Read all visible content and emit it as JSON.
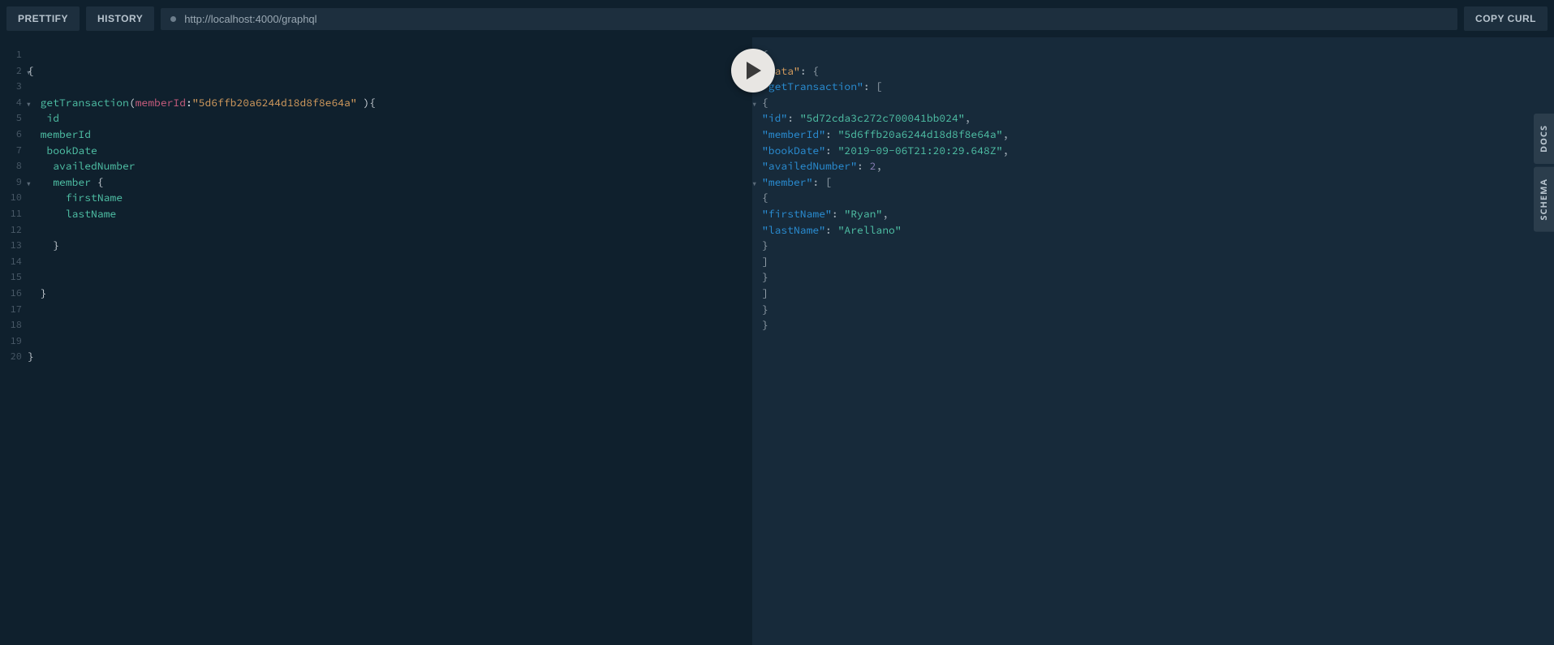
{
  "toolbar": {
    "prettify": "PRETTIFY",
    "history": "HISTORY",
    "copy_curl": "COPY CURL",
    "endpoint": "http://localhost:4000/graphql"
  },
  "side_tabs": {
    "docs": "DOCS",
    "schema": "SCHEMA"
  },
  "query": {
    "lines": [
      {
        "n": 1,
        "txt": ""
      },
      {
        "n": 2,
        "fold": true,
        "txt": "{"
      },
      {
        "n": 3,
        "txt": ""
      },
      {
        "n": 4,
        "fold": true,
        "seg": [
          [
            "  ",
            ""
          ],
          [
            "getTransaction",
            "field"
          ],
          [
            "(",
            "punc"
          ],
          [
            "memberId",
            "arg"
          ],
          [
            ":",
            "punc"
          ],
          [
            "\"5d6ffb20a6244d18d8f8e64a\"",
            "str"
          ],
          [
            " ){",
            "punc"
          ]
        ]
      },
      {
        "n": 5,
        "seg": [
          [
            "   ",
            ""
          ],
          [
            "id",
            "field"
          ]
        ]
      },
      {
        "n": 6,
        "seg": [
          [
            "  ",
            ""
          ],
          [
            "memberId",
            "field"
          ]
        ]
      },
      {
        "n": 7,
        "seg": [
          [
            "   ",
            ""
          ],
          [
            "bookDate",
            "field"
          ]
        ]
      },
      {
        "n": 8,
        "seg": [
          [
            "    ",
            ""
          ],
          [
            "availedNumber",
            "field"
          ]
        ]
      },
      {
        "n": 9,
        "fold": true,
        "seg": [
          [
            "    ",
            ""
          ],
          [
            "member",
            "field"
          ],
          [
            " {",
            "punc"
          ]
        ]
      },
      {
        "n": 10,
        "seg": [
          [
            "      ",
            ""
          ],
          [
            "firstName",
            "field"
          ]
        ]
      },
      {
        "n": 11,
        "seg": [
          [
            "      ",
            ""
          ],
          [
            "lastName",
            "field"
          ]
        ]
      },
      {
        "n": 12,
        "txt": ""
      },
      {
        "n": 13,
        "seg": [
          [
            "    }",
            "punc"
          ]
        ]
      },
      {
        "n": 14,
        "txt": ""
      },
      {
        "n": 15,
        "txt": ""
      },
      {
        "n": 16,
        "seg": [
          [
            "  }",
            "punc"
          ]
        ]
      },
      {
        "n": 17,
        "txt": ""
      },
      {
        "n": 18,
        "txt": ""
      },
      {
        "n": 19,
        "txt": ""
      },
      {
        "n": 20,
        "seg": [
          [
            "}",
            "punc"
          ]
        ]
      }
    ]
  },
  "result": {
    "lines": [
      {
        "fold": true,
        "ind": 0,
        "seg": [
          [
            "{",
            "punc"
          ]
        ]
      },
      {
        "fold": true,
        "ind": 1,
        "seg": [
          [
            "\"data\"",
            "key-data"
          ],
          [
            ": {",
            "punc"
          ]
        ]
      },
      {
        "fold": true,
        "ind": 2,
        "seg": [
          [
            "\"getTransaction\"",
            "key"
          ],
          [
            ": [",
            "punc"
          ]
        ]
      },
      {
        "fold": true,
        "ind": 3,
        "seg": [
          [
            "{",
            "punc"
          ]
        ]
      },
      {
        "ind": 4,
        "seg": [
          [
            "\"id\"",
            "key"
          ],
          [
            ": ",
            "punc"
          ],
          [
            "\"5d72cda3c272c700041bb024\"",
            "str"
          ],
          [
            ",",
            "punc"
          ]
        ]
      },
      {
        "ind": 4,
        "seg": [
          [
            "\"memberId\"",
            "key"
          ],
          [
            ": ",
            "punc"
          ],
          [
            "\"5d6ffb20a6244d18d8f8e64a\"",
            "str"
          ],
          [
            ",",
            "punc"
          ]
        ]
      },
      {
        "ind": 4,
        "seg": [
          [
            "\"bookDate\"",
            "key"
          ],
          [
            ": ",
            "punc"
          ],
          [
            "\"2019-09-06T21:20:29.648Z\"",
            "str"
          ],
          [
            ",",
            "punc"
          ]
        ]
      },
      {
        "ind": 4,
        "seg": [
          [
            "\"availedNumber\"",
            "key"
          ],
          [
            ": ",
            "punc"
          ],
          [
            "2",
            "num"
          ],
          [
            ",",
            "punc"
          ]
        ]
      },
      {
        "fold": true,
        "ind": 4,
        "seg": [
          [
            "\"member\"",
            "key"
          ],
          [
            ": [",
            "punc"
          ]
        ]
      },
      {
        "ind": 5,
        "seg": [
          [
            "{",
            "punc"
          ]
        ]
      },
      {
        "ind": 6,
        "seg": [
          [
            "\"firstName\"",
            "key"
          ],
          [
            ": ",
            "punc"
          ],
          [
            "\"Ryan\"",
            "str"
          ],
          [
            ",",
            "punc"
          ]
        ]
      },
      {
        "ind": 6,
        "seg": [
          [
            "\"lastName\"",
            "key"
          ],
          [
            ": ",
            "punc"
          ],
          [
            "\"Arellano\"",
            "str"
          ]
        ]
      },
      {
        "ind": 5,
        "seg": [
          [
            "}",
            "punc"
          ]
        ]
      },
      {
        "ind": 4,
        "seg": [
          [
            "]",
            "punc"
          ]
        ]
      },
      {
        "ind": 3,
        "seg": [
          [
            "}",
            "punc"
          ]
        ]
      },
      {
        "ind": 2,
        "seg": [
          [
            "]",
            "punc"
          ]
        ]
      },
      {
        "ind": 1,
        "seg": [
          [
            "}",
            "punc"
          ]
        ]
      },
      {
        "ind": 0,
        "seg": [
          [
            "}",
            "punc"
          ]
        ]
      }
    ]
  }
}
